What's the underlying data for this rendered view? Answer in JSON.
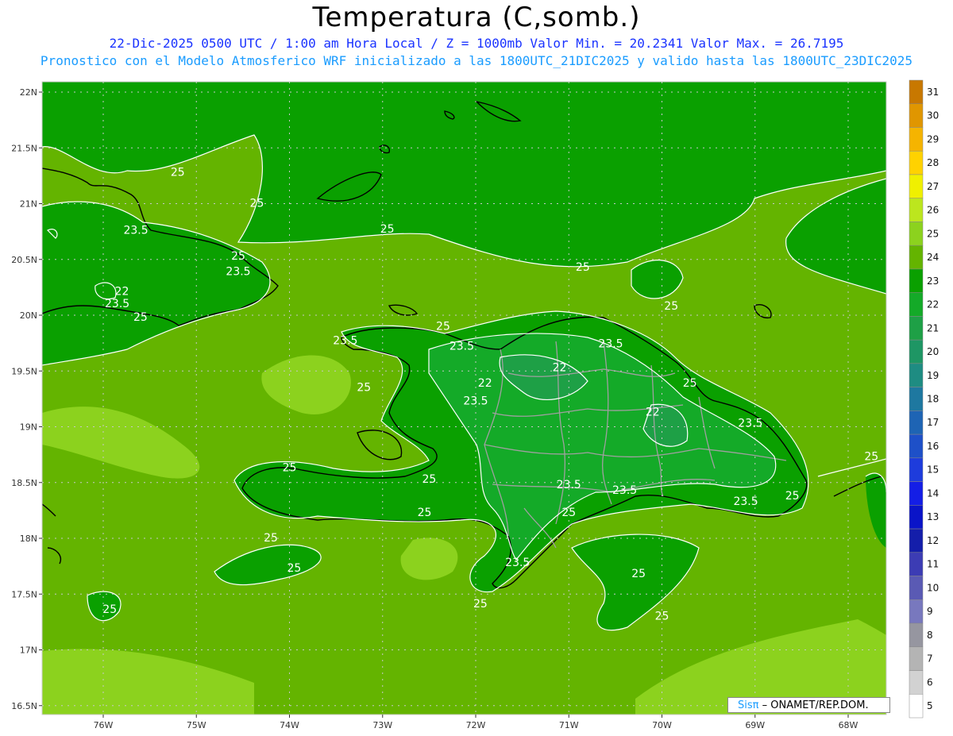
{
  "header": {
    "title": "Temperatura (C,somb.)",
    "line1": "22-Dic-2025  0500 UTC / 1:00 am Hora Local / Z = 1000mb   Valor Min. = 20.2341  Valor Max. = 26.7195",
    "line2": "Pronostico con el Modelo Atmosferico WRF inicializado a las 1800UTC_21DIC2025 y valido hasta las  1800UTC_23DIC2025"
  },
  "lat_labels": [
    "22N",
    "21.5N",
    "21N",
    "20.5N",
    "20N",
    "19.5N",
    "19N",
    "18.5N",
    "18N",
    "17.5N",
    "17N",
    "16.5N"
  ],
  "lon_labels": [
    "76W",
    "75W",
    "74W",
    "73W",
    "72W",
    "71W",
    "70W",
    "69W",
    "68W"
  ],
  "colorbar": {
    "labels": [
      "31",
      "30",
      "29",
      "28",
      "27",
      "26",
      "25",
      "24",
      "23",
      "22",
      "21",
      "20",
      "19",
      "18",
      "17",
      "16",
      "15",
      "14",
      "13",
      "12",
      "11",
      "10",
      "9",
      "8",
      "7",
      "6",
      "5"
    ],
    "colors": [
      "#c87800",
      "#e09600",
      "#f5b400",
      "#ffd200",
      "#f0f000",
      "#bce61e",
      "#8cd21e",
      "#64b400",
      "#0aa000",
      "#14aa28",
      "#1ea046",
      "#1e9664",
      "#1e8c82",
      "#1e78a0",
      "#1e64b4",
      "#1e50c8",
      "#1e3cdc",
      "#141ee6",
      "#0a14c8",
      "#141eaa",
      "#3c3cb4",
      "#5a5ab4",
      "#7878be",
      "#9696a0",
      "#b4b4b4",
      "#d2d2d2",
      "#ffffff"
    ]
  },
  "contour_labels": [
    {
      "text": "25",
      "lon": -75.2,
      "lat": 21.25
    },
    {
      "text": "25",
      "lon": -74.35,
      "lat": 20.97
    },
    {
      "text": "23.5",
      "lon": -75.65,
      "lat": 20.73
    },
    {
      "text": "25",
      "lon": -74.55,
      "lat": 20.5
    },
    {
      "text": "23.5",
      "lon": -74.55,
      "lat": 20.36
    },
    {
      "text": "22",
      "lon": -75.8,
      "lat": 20.18
    },
    {
      "text": "23.5",
      "lon": -75.85,
      "lat": 20.07
    },
    {
      "text": "25",
      "lon": -75.6,
      "lat": 19.95
    },
    {
      "text": "25",
      "lon": -72.95,
      "lat": 20.74
    },
    {
      "text": "25",
      "lon": -70.85,
      "lat": 20.4
    },
    {
      "text": "25",
      "lon": -69.9,
      "lat": 20.05
    },
    {
      "text": "25",
      "lon": -72.35,
      "lat": 19.87
    },
    {
      "text": "23.5",
      "lon": -73.4,
      "lat": 19.74
    },
    {
      "text": "23.5",
      "lon": -72.15,
      "lat": 19.69
    },
    {
      "text": "23.5",
      "lon": -70.55,
      "lat": 19.71
    },
    {
      "text": "22",
      "lon": -71.1,
      "lat": 19.5
    },
    {
      "text": "22",
      "lon": -71.9,
      "lat": 19.36
    },
    {
      "text": "25",
      "lon": -73.2,
      "lat": 19.32
    },
    {
      "text": "25",
      "lon": -69.7,
      "lat": 19.36
    },
    {
      "text": "23.5",
      "lon": -72.0,
      "lat": 19.2
    },
    {
      "text": "22",
      "lon": -70.1,
      "lat": 19.1
    },
    {
      "text": "23.5",
      "lon": -69.05,
      "lat": 19.0
    },
    {
      "text": "25",
      "lon": -67.75,
      "lat": 18.7
    },
    {
      "text": "25",
      "lon": -74.0,
      "lat": 18.6
    },
    {
      "text": "25",
      "lon": -72.5,
      "lat": 18.5
    },
    {
      "text": "23.5",
      "lon": -71.0,
      "lat": 18.45
    },
    {
      "text": "23.5",
      "lon": -70.4,
      "lat": 18.4
    },
    {
      "text": "25",
      "lon": -68.6,
      "lat": 18.35
    },
    {
      "text": "23.5",
      "lon": -69.1,
      "lat": 18.3
    },
    {
      "text": "25",
      "lon": -72.55,
      "lat": 18.2
    },
    {
      "text": "25",
      "lon": -71.0,
      "lat": 18.2
    },
    {
      "text": "25",
      "lon": -74.2,
      "lat": 17.97
    },
    {
      "text": "25",
      "lon": -73.95,
      "lat": 17.7
    },
    {
      "text": "23.5",
      "lon": -71.55,
      "lat": 17.75
    },
    {
      "text": "25",
      "lon": -70.25,
      "lat": 17.65
    },
    {
      "text": "25",
      "lon": -71.95,
      "lat": 17.38
    },
    {
      "text": "25",
      "lon": -70.0,
      "lat": 17.27
    },
    {
      "text": "25",
      "lon": -75.93,
      "lat": 17.33
    }
  ],
  "credit": {
    "brand": "Sisπ",
    "org": " –  ONAMET/REP.DOM."
  }
}
